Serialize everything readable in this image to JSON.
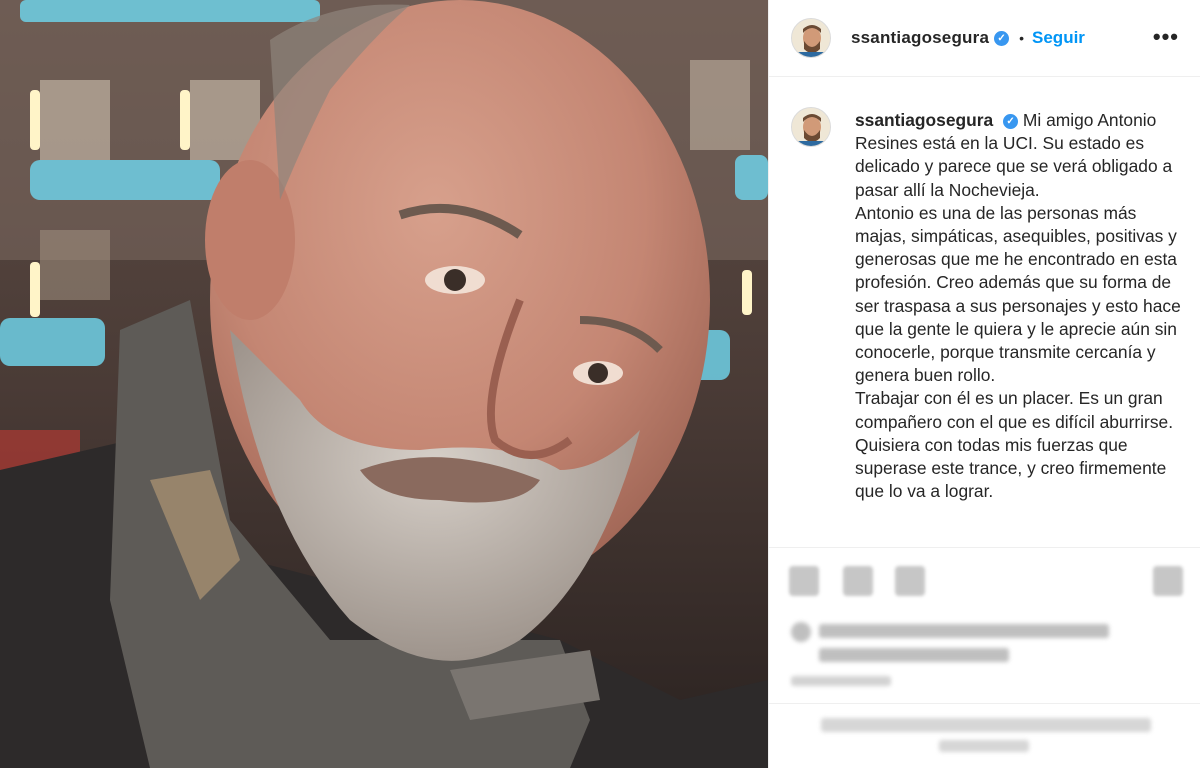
{
  "post": {
    "username": "ssantiagosegura",
    "verified_icon": "verified-badge-icon",
    "separator": "•",
    "follow_label": "Seguir",
    "more_label": "•••"
  },
  "caption": {
    "username": "ssantiagosegura",
    "paragraphs": [
      "Mi amigo Antonio Resines está en la UCI. Su estado es delicado y parece que se verá obligado a pasar allí la Nochevieja.",
      "Antonio es una de las personas más majas, simpáticas, asequibles, positivas y generosas que me he encontrado en esta profesión. Creo además que su forma de ser traspasa a sus personajes y esto hace que la gente le quiera y le aprecie aún sin conocerle, porque transmite cercanía y genera buen rollo.",
      "Trabajar con él es un placer. Es un gran compañero con el que es difícil aburrirse.",
      "Quisiera con todas mis fuerzas que superase este trance, y creo firmemente que lo va a lograr."
    ]
  },
  "actions": {
    "icons": [
      "heart-icon",
      "comment-icon",
      "share-icon",
      "save-icon"
    ]
  },
  "colors": {
    "link": "#0095f6",
    "text": "#262626",
    "border": "#efefef",
    "verified": "#3897f0"
  }
}
